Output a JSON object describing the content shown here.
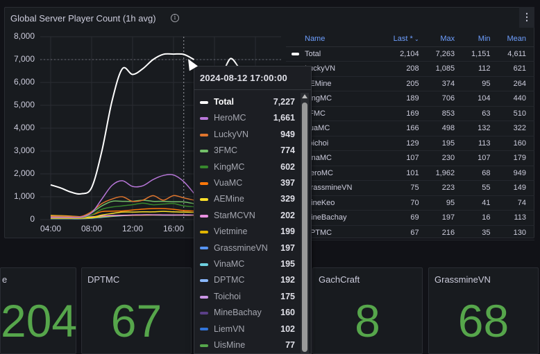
{
  "panel": {
    "title": "Global Server Player Count (1h avg)",
    "info_icon": "info-circle-icon",
    "menu_icon": "vertical-dots-icon"
  },
  "chart_data": {
    "type": "line",
    "title": "Global Server Player Count (1h avg)",
    "ylim": [
      0,
      8000
    ],
    "yticks": [
      "0",
      "1,000",
      "2,000",
      "3,000",
      "4,000",
      "5,000",
      "6,000",
      "7,000",
      "8,000"
    ],
    "xticks": [
      "04:00",
      "08:00",
      "12:00",
      "16:00"
    ],
    "x": [
      "04:00",
      "05:00",
      "06:00",
      "07:00",
      "08:00",
      "09:00",
      "10:00",
      "11:00",
      "12:00",
      "13:00",
      "14:00",
      "15:00",
      "16:00",
      "17:00",
      "18:00"
    ],
    "grid": true,
    "crosshair": "17:00",
    "series": [
      {
        "name": "Total",
        "color": "#ffffff",
        "values": [
          1520,
          1380,
          1200,
          1130,
          1400,
          3000,
          5200,
          6600,
          6350,
          6600,
          7000,
          7230,
          7240,
          7227,
          7000
        ]
      },
      {
        "name": "HeroMC",
        "color": "#b877d9",
        "values": [
          100,
          100,
          100,
          110,
          300,
          900,
          1500,
          1700,
          1450,
          1480,
          1750,
          1930,
          1950,
          1661,
          1150
        ]
      },
      {
        "name": "LuckyVN",
        "color": "#e0752d",
        "values": [
          150,
          150,
          140,
          140,
          350,
          700,
          900,
          1000,
          800,
          850,
          1050,
          850,
          1050,
          949,
          850
        ]
      },
      {
        "name": "3FMC",
        "color": "#73bf69",
        "values": [
          100,
          110,
          110,
          120,
          300,
          600,
          800,
          800,
          800,
          850,
          800,
          800,
          780,
          774,
          700
        ]
      },
      {
        "name": "KingMC",
        "color": "#37872d",
        "values": [
          100,
          100,
          100,
          100,
          200,
          450,
          550,
          600,
          650,
          720,
          650,
          680,
          700,
          602,
          560
        ]
      },
      {
        "name": "VuaMC",
        "color": "#ff780a",
        "values": [
          100,
          100,
          100,
          100,
          200,
          350,
          370,
          380,
          420,
          460,
          480,
          480,
          450,
          397,
          380
        ]
      },
      {
        "name": "AEMine",
        "color": "#fade2a",
        "values": [
          180,
          170,
          150,
          120,
          100,
          200,
          270,
          330,
          330,
          340,
          340,
          360,
          340,
          329,
          320
        ]
      },
      {
        "name": "StarMCVN",
        "color": "#e88fe0",
        "values": [
          120,
          110,
          100,
          100,
          120,
          160,
          180,
          190,
          200,
          210,
          210,
          205,
          200,
          202,
          200
        ]
      },
      {
        "name": "Vietmine",
        "color": "#e0b400",
        "values": [
          60,
          60,
          60,
          60,
          80,
          130,
          160,
          180,
          190,
          195,
          200,
          200,
          200,
          199,
          190
        ]
      },
      {
        "name": "VinaMC",
        "color": "#6ed0e0",
        "values": [
          40,
          40,
          40,
          40,
          60,
          100,
          140,
          170,
          190,
          200,
          200,
          195,
          195,
          195,
          190
        ]
      }
    ]
  },
  "tooltip": {
    "time": "2024-08-12 17:00:00",
    "rows": [
      {
        "name": "Total",
        "value": "7,227",
        "color": "#ffffff"
      },
      {
        "name": "HeroMC",
        "value": "1,661",
        "color": "#b877d9"
      },
      {
        "name": "LuckyVN",
        "value": "949",
        "color": "#e0752d"
      },
      {
        "name": "3FMC",
        "value": "774",
        "color": "#73bf69"
      },
      {
        "name": "KingMC",
        "value": "602",
        "color": "#37872d"
      },
      {
        "name": "VuaMC",
        "value": "397",
        "color": "#ff780a"
      },
      {
        "name": "AEMine",
        "value": "329",
        "color": "#fade2a"
      },
      {
        "name": "StarMCVN",
        "value": "202",
        "color": "#e88fe0"
      },
      {
        "name": "Vietmine",
        "value": "199",
        "color": "#e0b400"
      },
      {
        "name": "GrassmineVN",
        "value": "197",
        "color": "#5794f2"
      },
      {
        "name": "VinaMC",
        "value": "195",
        "color": "#6ed0e0"
      },
      {
        "name": "DPTMC",
        "value": "192",
        "color": "#8ab8ff"
      },
      {
        "name": "Toichoi",
        "value": "175",
        "color": "#ca95e5"
      },
      {
        "name": "MineBachay",
        "value": "160",
        "color": "#5a3f87"
      },
      {
        "name": "LiemVN",
        "value": "102",
        "color": "#3274d9"
      },
      {
        "name": "UisMine",
        "value": "77",
        "color": "#56a64b"
      }
    ]
  },
  "legend_table": {
    "headers": [
      "Name",
      "Last *",
      "Max",
      "Min",
      "Mean"
    ],
    "sort_icon": "chevron-down-icon",
    "rows": [
      {
        "name": "Total",
        "color": "#ffffff",
        "last": "2,104",
        "max": "7,263",
        "min": "1,151",
        "mean": "4,611"
      },
      {
        "name": "LuckyVN",
        "color": "#e0752d",
        "last": "208",
        "max": "1,085",
        "min": "112",
        "mean": "621"
      },
      {
        "name": "AEMine",
        "color": "#fade2a",
        "last": "205",
        "max": "374",
        "min": "95",
        "mean": "264"
      },
      {
        "name": "KingMC",
        "color": "#37872d",
        "last": "189",
        "max": "706",
        "min": "104",
        "mean": "440"
      },
      {
        "name": "3FMC",
        "color": "#73bf69",
        "last": "169",
        "max": "853",
        "min": "63",
        "mean": "510"
      },
      {
        "name": "VuaMC",
        "color": "#ff780a",
        "last": "166",
        "max": "498",
        "min": "132",
        "mean": "322"
      },
      {
        "name": "Toichoi",
        "color": "#ca95e5",
        "last": "129",
        "max": "195",
        "min": "113",
        "mean": "160"
      },
      {
        "name": "VinaMC",
        "color": "#6ed0e0",
        "last": "107",
        "max": "230",
        "min": "107",
        "mean": "179"
      },
      {
        "name": "HeroMC",
        "color": "#b877d9",
        "last": "101",
        "max": "1,962",
        "min": "68",
        "mean": "949"
      },
      {
        "name": "GrassmineVN",
        "color": "#5794f2",
        "last": "75",
        "max": "223",
        "min": "55",
        "mean": "149"
      },
      {
        "name": "MineKeo",
        "color": "#c4162a",
        "last": "70",
        "max": "95",
        "min": "41",
        "mean": "74"
      },
      {
        "name": "MineBachay",
        "color": "#5a3f87",
        "last": "69",
        "max": "197",
        "min": "16",
        "mean": "113"
      },
      {
        "name": "DPTMC",
        "color": "#8ab8ff",
        "last": "67",
        "max": "216",
        "min": "35",
        "mean": "130"
      }
    ]
  },
  "stats": [
    {
      "title": "e",
      "value": "204"
    },
    {
      "title": "DPTMC",
      "value": "67"
    },
    {
      "title": "",
      "value": ""
    },
    {
      "title": "GachCraft",
      "value": "8"
    },
    {
      "title": "GrassmineVN",
      "value": "68"
    }
  ],
  "stat_color": "#56a64b"
}
